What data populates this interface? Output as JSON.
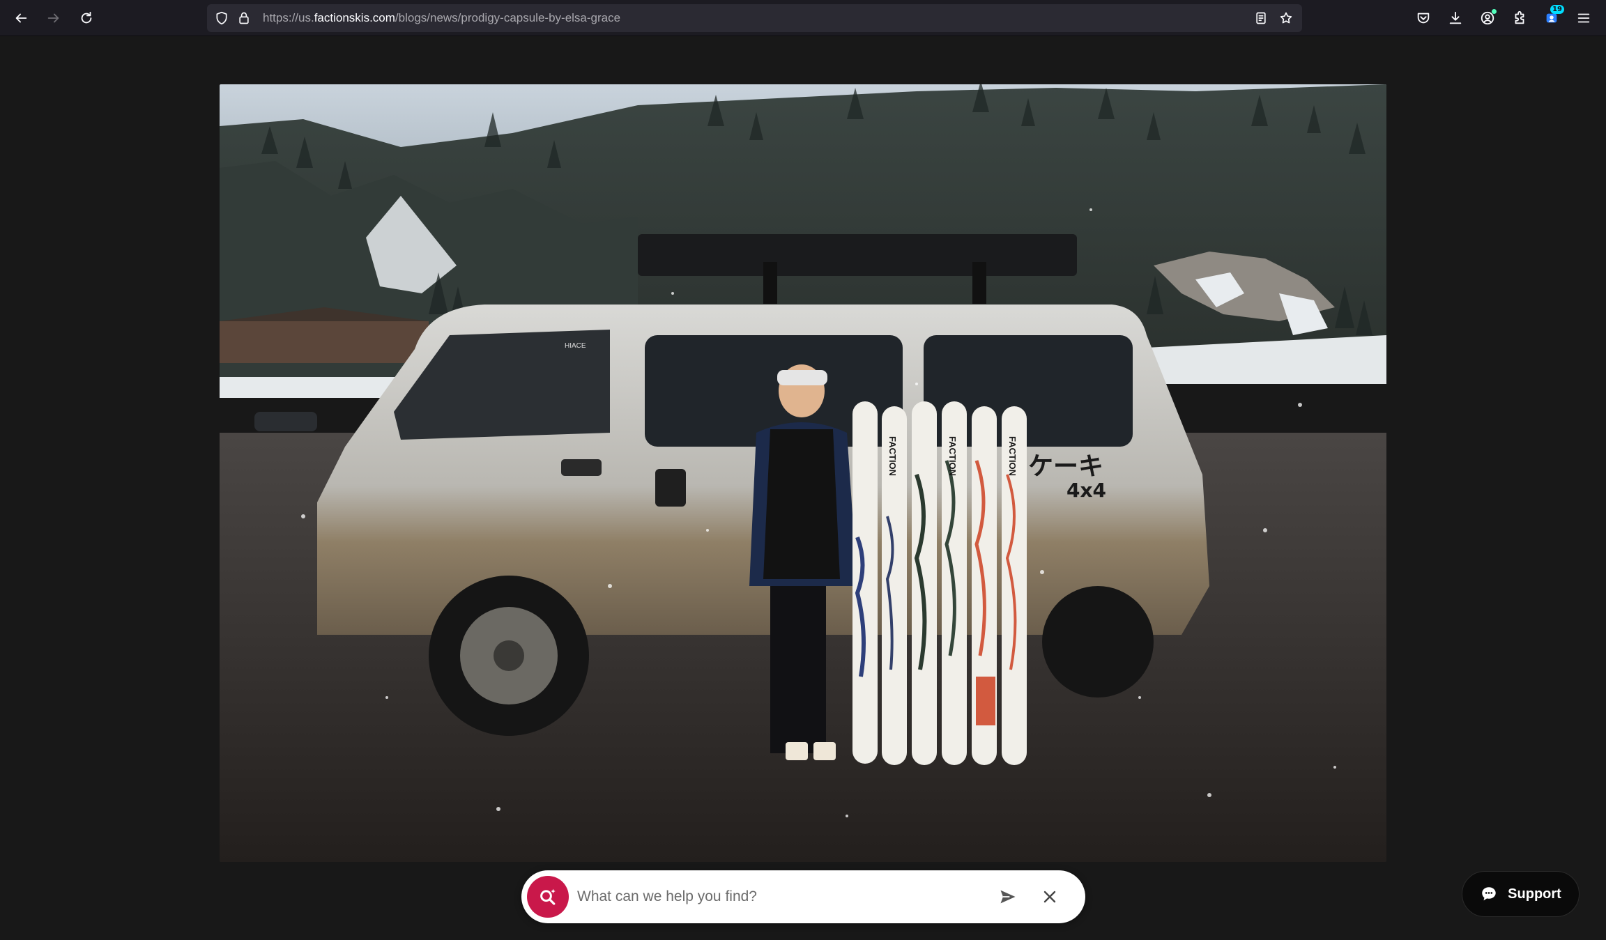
{
  "browser": {
    "url_prefix": "https://us.",
    "url_domain": "factionskis.com",
    "url_path": "/blogs/news/prodigy-capsule-by-elsa-grace",
    "extensions_badge": "19"
  },
  "photo": {
    "van_model": "HIACE",
    "van_text": "ケーキ",
    "van_text_sub": "4x4",
    "ski_brand": "FACTION"
  },
  "search": {
    "placeholder": "What can we help you find?"
  },
  "support": {
    "label": "Support"
  }
}
